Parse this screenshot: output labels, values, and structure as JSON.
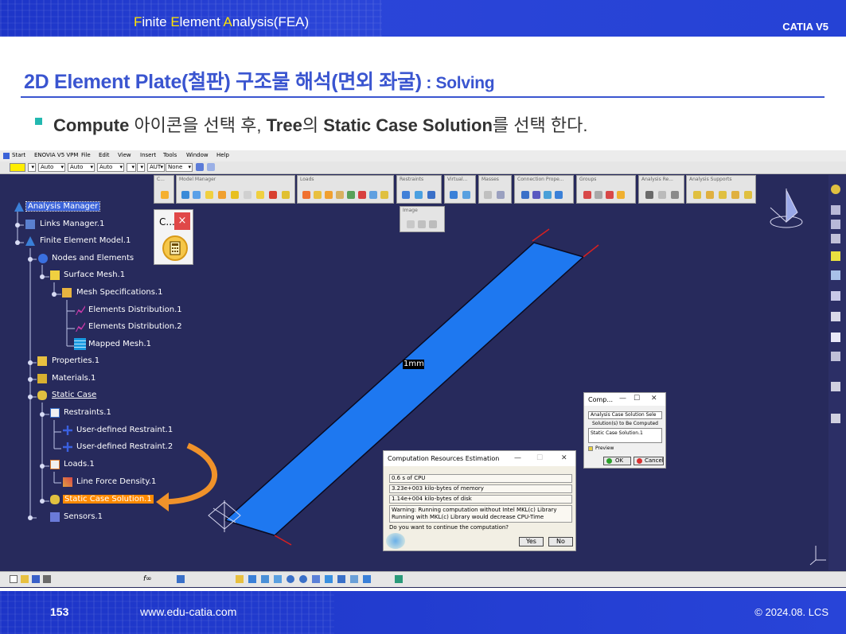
{
  "header": {
    "title_parts": [
      "F",
      "inite ",
      "E",
      "lement ",
      "A",
      "nalysis(FEA)"
    ],
    "brand": "CATIA V5"
  },
  "slide": {
    "title": "2D Element Plate(철판) 구조물 해석(면외 좌굴)",
    "title_suffix": " : Solving",
    "bullet_b1": "Compute",
    "bullet_t1": " 아이콘을 선택 후, ",
    "bullet_b2": "Tree",
    "bullet_t2": "의 ",
    "bullet_b3": "Static Case Solution",
    "bullet_t3": "를 선택 한다."
  },
  "menubar": {
    "items": [
      "Start",
      "ENOVIA V5 VPM",
      "File",
      "Edit",
      "View",
      "Insert",
      "Tools",
      "Window",
      "Help"
    ]
  },
  "toolbar2": {
    "combos": [
      "Auto",
      "Auto",
      "Auto",
      "",
      "",
      "AUT",
      "None"
    ]
  },
  "toolboxes": [
    {
      "title": "C..."
    },
    {
      "title": "Model Manager"
    },
    {
      "title": "Loads"
    },
    {
      "title": "Restraints"
    },
    {
      "title": "Virtual..."
    },
    {
      "title": "Masses"
    },
    {
      "title": "Connection Prope..."
    },
    {
      "title": "Groups"
    },
    {
      "title": "Analysis Re..."
    },
    {
      "title": "Analysis Supports"
    },
    {
      "title": "Image"
    }
  ],
  "tree": {
    "items": [
      "Analysis Manager",
      "Links Manager.1",
      "Finite Element Model.1",
      "Nodes and Elements",
      "Surface Mesh.1",
      "Mesh Specifications.1",
      "Elements Distribution.1",
      "Elements Distribution.2",
      "Mapped Mesh.1",
      "Properties.1",
      "Materials.1",
      "Static Case",
      "Restraints.1",
      "User-defined Restraint.1",
      "User-defined Restraint.2",
      "Loads.1",
      "Line Force Density.1",
      "Static Case Solution.1",
      "Sensors.1"
    ]
  },
  "viewport": {
    "dimension_label": "1mm",
    "plate_color": "#1e78f0"
  },
  "compute_mini": {
    "title": "C...",
    "close": "×"
  },
  "compute_dialog": {
    "title": "Comp...",
    "select_value": "Analysis Case Solution Sele",
    "group_label": "Solution(s) to Be Computed",
    "list_item": "Static Case Solution.1",
    "preview_label": "Preview",
    "ok": "OK",
    "cancel": "Cancel"
  },
  "resources_dialog": {
    "title": "Computation Resources Estimation",
    "cpu": "0.6 s of CPU",
    "memory": "3.23e+003 kilo-bytes of memory",
    "disk": "1.14e+004 kilo-bytes of disk",
    "warning1": "Warning: Running computation without Intel MKL(c) Library",
    "warning2": "Running with MKL(c) Library would decrease CPU-Time",
    "question": "Do you want to continue the computation?",
    "yes": "Yes",
    "no": "No"
  },
  "footer": {
    "page": "153",
    "url": "www.edu-catia.com",
    "copyright": "© 2024.08. LCS"
  },
  "colors": {
    "accent": "#3a55d0",
    "background": "#272a5c",
    "selection": "#ff8a00",
    "arrow": "#f0922a"
  }
}
